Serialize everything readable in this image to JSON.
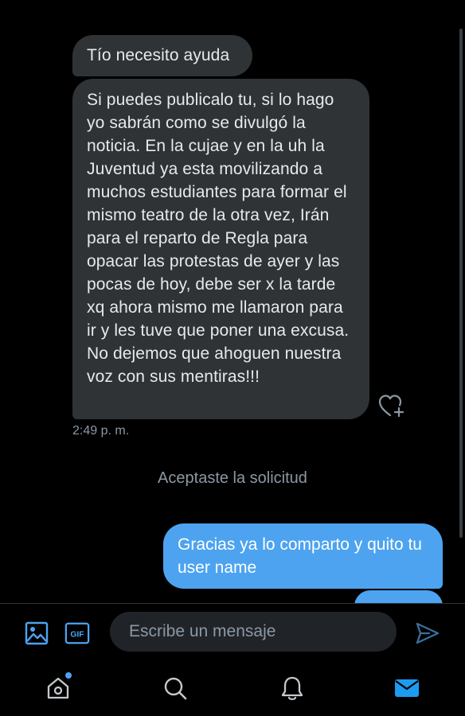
{
  "colors": {
    "incoming_bubble": "#2f3336",
    "outgoing_bubble": "#4da3f0",
    "accent": "#1d9bf0"
  },
  "messages": [
    {
      "direction": "incoming",
      "text": "Tío necesito ayuda"
    },
    {
      "direction": "incoming",
      "text": "Si puedes publicalo tu, si lo hago yo sabrán como se divulgó la noticia. En la cujae y en la uh la Juventud ya esta movilizando a muchos estudiantes para formar el mismo teatro de la otra vez, Irán para el reparto de Regla para opacar las protestas de ayer y las pocas de hoy, debe ser x la tarde xq ahora mismo me llamaron para ir y les tuve que poner una excusa. No dejemos que ahoguen nuestra voz con sus mentiras!!!"
    },
    {
      "direction": "outgoing",
      "text": "Gracias ya lo comparto y quito tu user name"
    }
  ],
  "timestamp": "2:49 p. m.",
  "system_message": "Aceptaste la solicitud",
  "composer": {
    "placeholder": "Escribe un mensaje",
    "icons": [
      "image-icon",
      "gif-icon",
      "send-icon"
    ]
  },
  "tabs": [
    {
      "icon": "home-icon",
      "has_notification": true
    },
    {
      "icon": "search-icon"
    },
    {
      "icon": "bell-icon"
    },
    {
      "icon": "mail-icon",
      "active": true
    }
  ]
}
